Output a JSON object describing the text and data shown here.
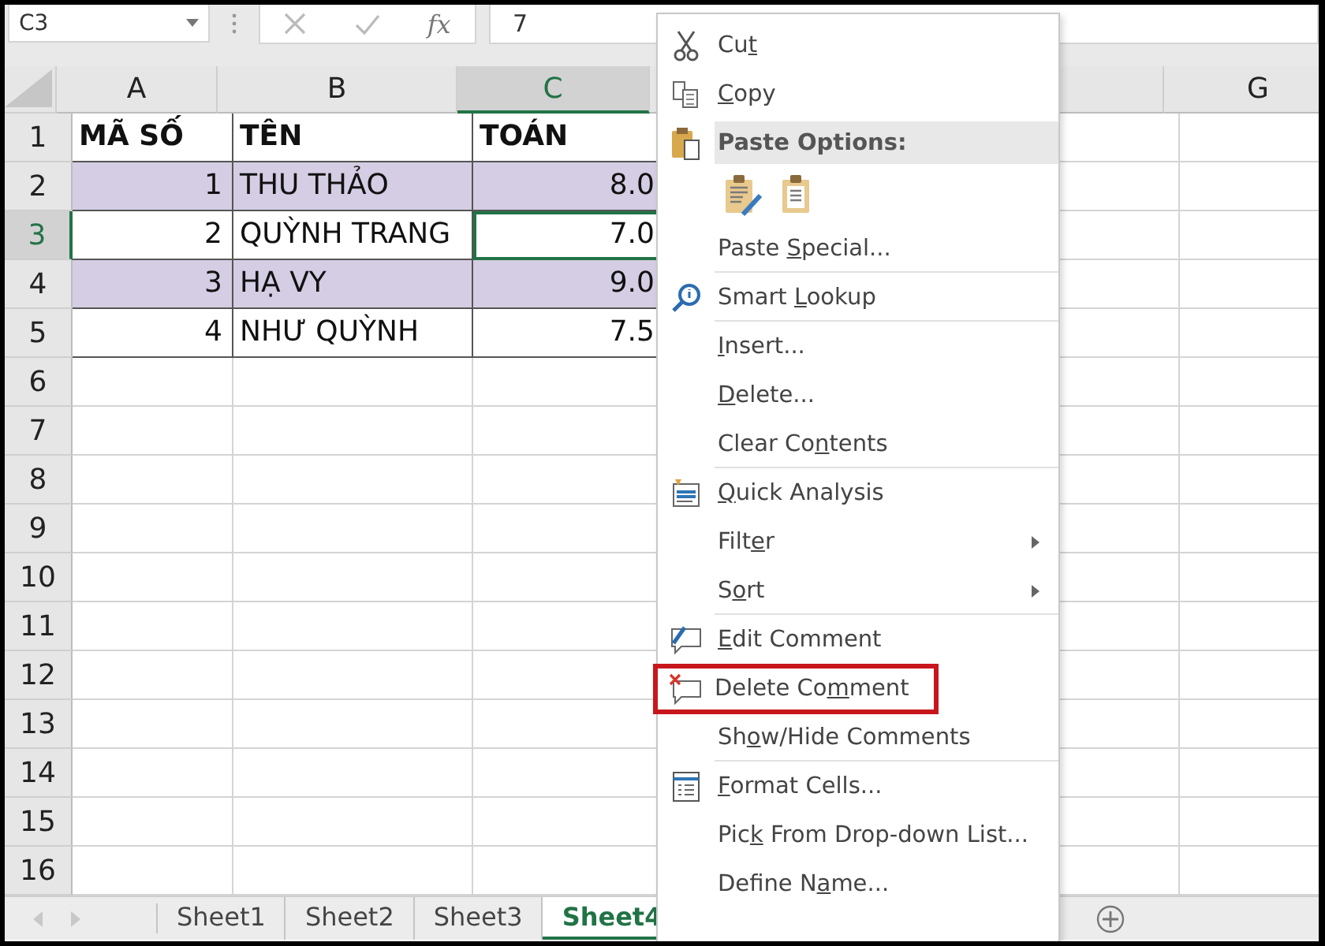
{
  "formula_bar": {
    "name_box": "C3",
    "fx": "fx",
    "value": "7"
  },
  "columns": [
    {
      "label": "A",
      "selected": false
    },
    {
      "label": "B",
      "selected": false
    },
    {
      "label": "C",
      "selected": true
    },
    {
      "label": "G",
      "selected": false
    }
  ],
  "rows": [
    {
      "header": "1",
      "bold": true,
      "shaded": false,
      "selected": false,
      "cells": [
        "MÃ SỐ",
        "TÊN",
        "TOÁN"
      ]
    },
    {
      "header": "2",
      "bold": false,
      "shaded": true,
      "selected": false,
      "cells": [
        "1",
        "THU THẢO",
        "8.0"
      ]
    },
    {
      "header": "3",
      "bold": false,
      "shaded": false,
      "selected": true,
      "cells": [
        "2",
        "QUỲNH TRANG",
        "7.0"
      ]
    },
    {
      "header": "4",
      "bold": false,
      "shaded": true,
      "selected": false,
      "cells": [
        "3",
        "HẠ VY",
        "9.0"
      ]
    },
    {
      "header": "5",
      "bold": false,
      "shaded": false,
      "selected": false,
      "cells": [
        "4",
        "NHƯ QUỲNH",
        "7.5"
      ]
    },
    {
      "header": "6"
    },
    {
      "header": "7"
    },
    {
      "header": "8"
    },
    {
      "header": "9"
    },
    {
      "header": "10"
    },
    {
      "header": "11"
    },
    {
      "header": "12"
    },
    {
      "header": "13"
    },
    {
      "header": "14"
    },
    {
      "header": "15"
    },
    {
      "header": "16"
    }
  ],
  "sheet_tabs": [
    {
      "label": "Sheet1",
      "selected": false
    },
    {
      "label": "Sheet2",
      "selected": false
    },
    {
      "label": "Sheet3",
      "selected": false
    },
    {
      "label": "Sheet4",
      "selected": true
    }
  ],
  "context_menu": [
    {
      "kind": "item",
      "label": {
        "pre": "Cu",
        "key": "t"
      },
      "submenu": false,
      "separator_after": false,
      "annotated": false
    },
    {
      "kind": "item",
      "label": {
        "key": "C",
        "post": "opy"
      },
      "submenu": false,
      "separator_after": false,
      "annotated": false
    },
    {
      "kind": "header",
      "label": {
        "pre": "Paste Options:"
      }
    },
    {
      "kind": "paste-icons"
    },
    {
      "kind": "item",
      "label": {
        "pre": "Paste ",
        "key": "S",
        "post": "pecial..."
      },
      "submenu": false,
      "separator_after": true,
      "annotated": false
    },
    {
      "kind": "item",
      "label": {
        "pre": "Smart ",
        "key": "L",
        "post": "ookup"
      },
      "submenu": false,
      "separator_after": true,
      "annotated": false
    },
    {
      "kind": "item",
      "label": {
        "key": "I",
        "post": "nsert..."
      },
      "submenu": false,
      "separator_after": false,
      "annotated": false
    },
    {
      "kind": "item",
      "label": {
        "key": "D",
        "post": "elete..."
      },
      "submenu": false,
      "separator_after": false,
      "annotated": false
    },
    {
      "kind": "item",
      "label": {
        "pre": "Clear Co",
        "key": "n",
        "post": "tents"
      },
      "submenu": false,
      "separator_after": true,
      "annotated": false
    },
    {
      "kind": "item",
      "label": {
        "key": "Q",
        "post": "uick Analysis"
      },
      "submenu": false,
      "separator_after": false,
      "annotated": false
    },
    {
      "kind": "item",
      "label": {
        "pre": "Filt",
        "key": "e",
        "post": "r"
      },
      "submenu": true,
      "separator_after": false,
      "annotated": false
    },
    {
      "kind": "item",
      "label": {
        "pre": "S",
        "key": "o",
        "post": "rt"
      },
      "submenu": true,
      "separator_after": true,
      "annotated": false
    },
    {
      "kind": "item",
      "label": {
        "key": "E",
        "post": "dit Comment"
      },
      "submenu": false,
      "separator_after": false,
      "annotated": false
    },
    {
      "kind": "item",
      "label": {
        "pre": "Delete Co",
        "key": "m",
        "post": "ment"
      },
      "submenu": false,
      "separator_after": false,
      "annotated": true
    },
    {
      "kind": "item",
      "label": {
        "pre": "Sh",
        "key": "o",
        "post": "w/Hide Comments"
      },
      "submenu": false,
      "separator_after": true,
      "annotated": false
    },
    {
      "kind": "item",
      "label": {
        "key": "F",
        "post": "ormat Cells..."
      },
      "submenu": false,
      "separator_after": false,
      "annotated": false
    },
    {
      "kind": "item",
      "label": {
        "pre": "Pic",
        "key": "k",
        "post": " From Drop-down List..."
      },
      "submenu": false,
      "separator_after": false,
      "annotated": false
    },
    {
      "kind": "item",
      "label": {
        "pre": "Define N",
        "key": "a",
        "post": "me..."
      },
      "submenu": false,
      "separator_after": false,
      "annotated": false
    }
  ]
}
